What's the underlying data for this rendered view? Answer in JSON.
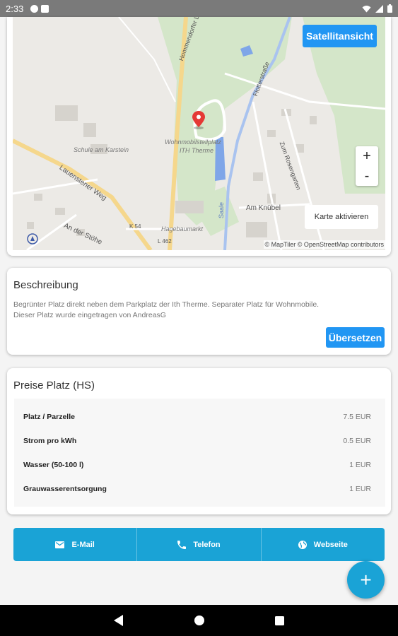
{
  "status_bar": {
    "time": "2:33",
    "icons": [
      "p-icon",
      "sim-card-icon",
      "wifi-icon",
      "signal-icon",
      "battery-icon"
    ]
  },
  "map": {
    "satellite_button": "Satellitansicht",
    "zoom_in": "+",
    "zoom_out": "-",
    "activate_button": "Karte aktivieren",
    "attribution": "© MapTiler © OpenStreetMap contributors",
    "labels": {
      "road_hommendorfer": "Hommendorfer Landstraße",
      "road_flotterstrasse": "Flotterstraße",
      "school": "Schule am Karstein",
      "wohnmobil": "Wohnmobilstellplatz",
      "therme": "ITH Therme",
      "ravensberg": "Lauenstener Weg",
      "am_knubel": "Am Knübel",
      "am_rosengarten": "Zum Rosengarten",
      "saale": "Saale",
      "hagebaumarkt": "Hagebaumarkt",
      "k54": "K 54",
      "l462": "L 462",
      "an_der_stöhe": "An der Stöhe"
    }
  },
  "description": {
    "title": "Beschreibung",
    "line1": "Begrünter Platz direkt neben dem Parkplatz der Ith Therme. Separater Platz für Wohnmobile.",
    "line2": "Dieser Platz wurde eingetragen von AndreasG",
    "translate_button": "Übersetzen"
  },
  "prices": {
    "title": "Preise Platz (HS)",
    "rows": [
      {
        "label": "Platz / Parzelle",
        "value": "7.5 EUR"
      },
      {
        "label": "Strom pro kWh",
        "value": "0.5 EUR"
      },
      {
        "label": "Wasser (50-100 l)",
        "value": "1 EUR"
      },
      {
        "label": "Grauwasserentsorgung",
        "value": "1 EUR"
      }
    ]
  },
  "actions": {
    "email": "E-Mail",
    "phone": "Telefon",
    "website": "Webseite"
  },
  "fab": "+",
  "colors": {
    "accent": "#1aa3d6",
    "button_blue": "#2196f3",
    "pin_red": "#e53935"
  }
}
